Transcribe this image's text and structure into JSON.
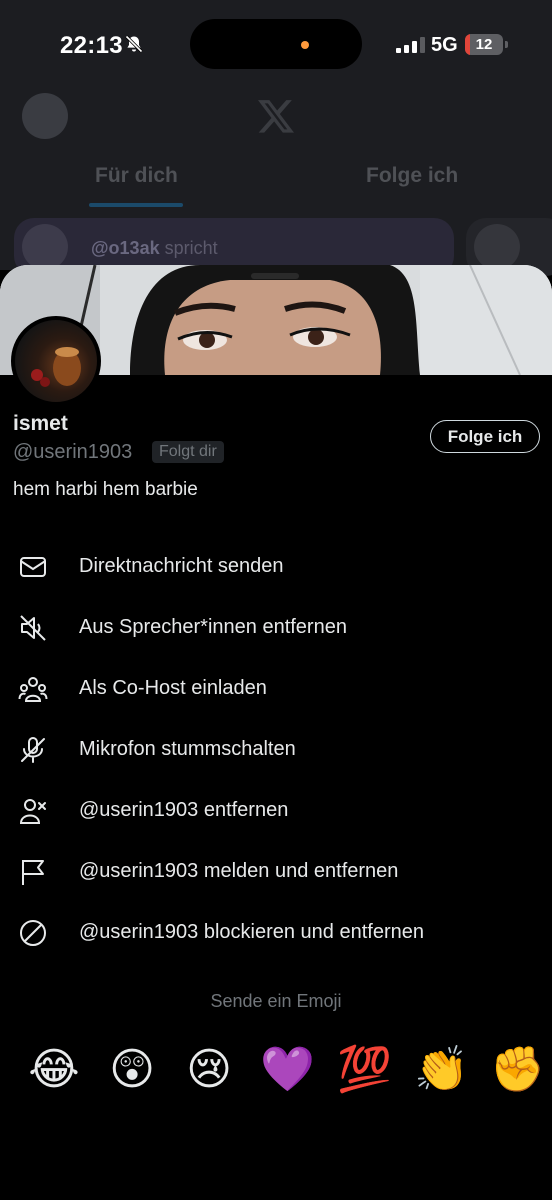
{
  "status_bar": {
    "time": "22:13",
    "network": "5G",
    "battery": "12",
    "battery_fraction": 0.12,
    "bell_icon": "bell-slash-icon"
  },
  "background": {
    "tab_for_you": "Für dich",
    "tab_following": "Folge ich",
    "space_user": "@o13ak",
    "space_status": "spricht",
    "logo_icon": "x-logo-icon"
  },
  "profile": {
    "name": "ismet",
    "handle": "@userin1903",
    "follows_you_badge": "Folgt dir",
    "follow_button": "Folge ich",
    "bio": "hem harbi hem barbie"
  },
  "menu": {
    "items": [
      {
        "label": "Direktnachricht senden",
        "icon": "mail-icon"
      },
      {
        "label": "Aus Sprecher*innen entfernen",
        "icon": "speaker-off-icon"
      },
      {
        "label": "Als Co-Host einladen",
        "icon": "people-icon"
      },
      {
        "label": "Mikrofon stummschalten",
        "icon": "mic-off-icon"
      },
      {
        "label": "@userin1903 entfernen",
        "icon": "user-remove-icon"
      },
      {
        "label": "@userin1903 melden und entfernen",
        "icon": "flag-icon"
      },
      {
        "label": "@userin1903 blockieren und entfernen",
        "icon": "block-icon"
      }
    ]
  },
  "emoji": {
    "title": "Sende ein Emoji",
    "items": [
      "😂",
      "😲",
      "😢",
      "💜",
      "💯",
      "👏",
      "✊"
    ]
  }
}
